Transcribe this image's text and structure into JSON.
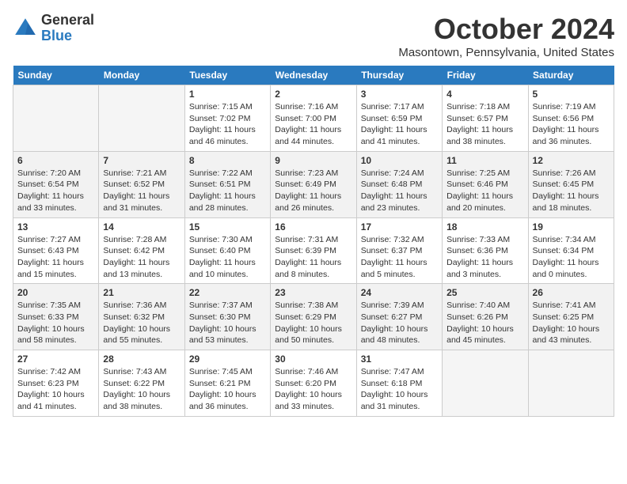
{
  "header": {
    "logo_line1": "General",
    "logo_line2": "Blue",
    "month_title": "October 2024",
    "subtitle": "Masontown, Pennsylvania, United States"
  },
  "days_of_week": [
    "Sunday",
    "Monday",
    "Tuesday",
    "Wednesday",
    "Thursday",
    "Friday",
    "Saturday"
  ],
  "weeks": [
    [
      {
        "day": "",
        "info": ""
      },
      {
        "day": "",
        "info": ""
      },
      {
        "day": "1",
        "info": "Sunrise: 7:15 AM\nSunset: 7:02 PM\nDaylight: 11 hours and 46 minutes."
      },
      {
        "day": "2",
        "info": "Sunrise: 7:16 AM\nSunset: 7:00 PM\nDaylight: 11 hours and 44 minutes."
      },
      {
        "day": "3",
        "info": "Sunrise: 7:17 AM\nSunset: 6:59 PM\nDaylight: 11 hours and 41 minutes."
      },
      {
        "day": "4",
        "info": "Sunrise: 7:18 AM\nSunset: 6:57 PM\nDaylight: 11 hours and 38 minutes."
      },
      {
        "day": "5",
        "info": "Sunrise: 7:19 AM\nSunset: 6:56 PM\nDaylight: 11 hours and 36 minutes."
      }
    ],
    [
      {
        "day": "6",
        "info": "Sunrise: 7:20 AM\nSunset: 6:54 PM\nDaylight: 11 hours and 33 minutes."
      },
      {
        "day": "7",
        "info": "Sunrise: 7:21 AM\nSunset: 6:52 PM\nDaylight: 11 hours and 31 minutes."
      },
      {
        "day": "8",
        "info": "Sunrise: 7:22 AM\nSunset: 6:51 PM\nDaylight: 11 hours and 28 minutes."
      },
      {
        "day": "9",
        "info": "Sunrise: 7:23 AM\nSunset: 6:49 PM\nDaylight: 11 hours and 26 minutes."
      },
      {
        "day": "10",
        "info": "Sunrise: 7:24 AM\nSunset: 6:48 PM\nDaylight: 11 hours and 23 minutes."
      },
      {
        "day": "11",
        "info": "Sunrise: 7:25 AM\nSunset: 6:46 PM\nDaylight: 11 hours and 20 minutes."
      },
      {
        "day": "12",
        "info": "Sunrise: 7:26 AM\nSunset: 6:45 PM\nDaylight: 11 hours and 18 minutes."
      }
    ],
    [
      {
        "day": "13",
        "info": "Sunrise: 7:27 AM\nSunset: 6:43 PM\nDaylight: 11 hours and 15 minutes."
      },
      {
        "day": "14",
        "info": "Sunrise: 7:28 AM\nSunset: 6:42 PM\nDaylight: 11 hours and 13 minutes."
      },
      {
        "day": "15",
        "info": "Sunrise: 7:30 AM\nSunset: 6:40 PM\nDaylight: 11 hours and 10 minutes."
      },
      {
        "day": "16",
        "info": "Sunrise: 7:31 AM\nSunset: 6:39 PM\nDaylight: 11 hours and 8 minutes."
      },
      {
        "day": "17",
        "info": "Sunrise: 7:32 AM\nSunset: 6:37 PM\nDaylight: 11 hours and 5 minutes."
      },
      {
        "day": "18",
        "info": "Sunrise: 7:33 AM\nSunset: 6:36 PM\nDaylight: 11 hours and 3 minutes."
      },
      {
        "day": "19",
        "info": "Sunrise: 7:34 AM\nSunset: 6:34 PM\nDaylight: 11 hours and 0 minutes."
      }
    ],
    [
      {
        "day": "20",
        "info": "Sunrise: 7:35 AM\nSunset: 6:33 PM\nDaylight: 10 hours and 58 minutes."
      },
      {
        "day": "21",
        "info": "Sunrise: 7:36 AM\nSunset: 6:32 PM\nDaylight: 10 hours and 55 minutes."
      },
      {
        "day": "22",
        "info": "Sunrise: 7:37 AM\nSunset: 6:30 PM\nDaylight: 10 hours and 53 minutes."
      },
      {
        "day": "23",
        "info": "Sunrise: 7:38 AM\nSunset: 6:29 PM\nDaylight: 10 hours and 50 minutes."
      },
      {
        "day": "24",
        "info": "Sunrise: 7:39 AM\nSunset: 6:27 PM\nDaylight: 10 hours and 48 minutes."
      },
      {
        "day": "25",
        "info": "Sunrise: 7:40 AM\nSunset: 6:26 PM\nDaylight: 10 hours and 45 minutes."
      },
      {
        "day": "26",
        "info": "Sunrise: 7:41 AM\nSunset: 6:25 PM\nDaylight: 10 hours and 43 minutes."
      }
    ],
    [
      {
        "day": "27",
        "info": "Sunrise: 7:42 AM\nSunset: 6:23 PM\nDaylight: 10 hours and 41 minutes."
      },
      {
        "day": "28",
        "info": "Sunrise: 7:43 AM\nSunset: 6:22 PM\nDaylight: 10 hours and 38 minutes."
      },
      {
        "day": "29",
        "info": "Sunrise: 7:45 AM\nSunset: 6:21 PM\nDaylight: 10 hours and 36 minutes."
      },
      {
        "day": "30",
        "info": "Sunrise: 7:46 AM\nSunset: 6:20 PM\nDaylight: 10 hours and 33 minutes."
      },
      {
        "day": "31",
        "info": "Sunrise: 7:47 AM\nSunset: 6:18 PM\nDaylight: 10 hours and 31 minutes."
      },
      {
        "day": "",
        "info": ""
      },
      {
        "day": "",
        "info": ""
      }
    ]
  ]
}
